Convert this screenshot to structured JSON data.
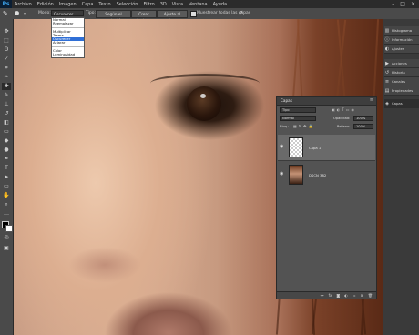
{
  "menubar": {
    "logo": "Ps",
    "items": [
      "Archivo",
      "Edición",
      "Imagen",
      "Capa",
      "Texto",
      "Selección",
      "Filtro",
      "3D",
      "Vista",
      "Ventana",
      "Ayuda"
    ],
    "window_buttons": [
      "–",
      "□",
      "×"
    ]
  },
  "options": {
    "modo_label": "Modo:",
    "modo_value": "Oscurecer",
    "tipo_label": "Tipo:",
    "btn_segun": "Según el contenido",
    "btn_crear": "Crear textura",
    "btn_ajuste": "Ajuste al entorno",
    "sample_all_label": "Muestrear todas las capas"
  },
  "dropdown": {
    "items": [
      "Normal",
      "Reemplazar",
      "",
      "Multiplicar",
      "Trama",
      "Oscurecer",
      "Aclarar",
      "",
      "Color",
      "Luminosidad"
    ],
    "selected": "Oscurecer"
  },
  "dock": {
    "items": [
      {
        "icon": "▥",
        "label": "Histograma"
      },
      {
        "icon": "ⓘ",
        "label": "Información"
      },
      {
        "icon": "◐",
        "label": "Ajustes"
      },
      {
        "icon": "▶",
        "label": "Acciones"
      },
      {
        "icon": "↺",
        "label": "Historia"
      },
      {
        "icon": "≡",
        "label": "Canales"
      },
      {
        "icon": "▤",
        "label": "Propiedades"
      },
      {
        "icon": "◈",
        "label": "Capas"
      }
    ]
  },
  "layers_panel": {
    "title": "Capas",
    "filter": "Tipo",
    "blend": "Normal",
    "opacity_label": "Opacidad:",
    "opacity_value": "100%",
    "lock_label": "Bloq.:",
    "fill_label": "Relleno:",
    "fill_value": "100%",
    "layers": [
      {
        "name": "Capa 1",
        "selected": true
      },
      {
        "name": "DSCN 382",
        "selected": false
      }
    ],
    "footer_icons": [
      "fx",
      "◙",
      "◐",
      "▭",
      "⊞",
      "🗑"
    ]
  }
}
